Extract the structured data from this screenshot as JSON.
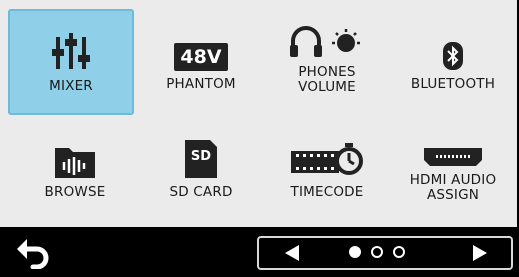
{
  "tiles": [
    {
      "label": "MIXER",
      "icon": "mixer-faders-icon",
      "selected": true
    },
    {
      "label": "PHANTOM",
      "icon": "phantom-48v-icon",
      "badge": "48V"
    },
    {
      "label_line1": "PHONES",
      "label_line2": "VOLUME",
      "icon": "headphones-volume-icon"
    },
    {
      "label": "BLUETOOTH",
      "icon": "bluetooth-icon"
    },
    {
      "label": "BROWSE",
      "icon": "folder-waveform-icon"
    },
    {
      "label": "SD CARD",
      "icon": "sd-card-icon",
      "badge": "SD"
    },
    {
      "label": "TIMECODE",
      "icon": "timecode-icon"
    },
    {
      "label_line1": "HDMI AUDIO",
      "label_line2": "ASSIGN",
      "icon": "hdmi-connector-icon"
    }
  ],
  "pager": {
    "pages": 3,
    "current": 1
  },
  "colors": {
    "selected_bg": "#8fd0e8",
    "panel_bg": "#ebebeb",
    "bar_bg": "#000000",
    "icon": "#222222"
  }
}
